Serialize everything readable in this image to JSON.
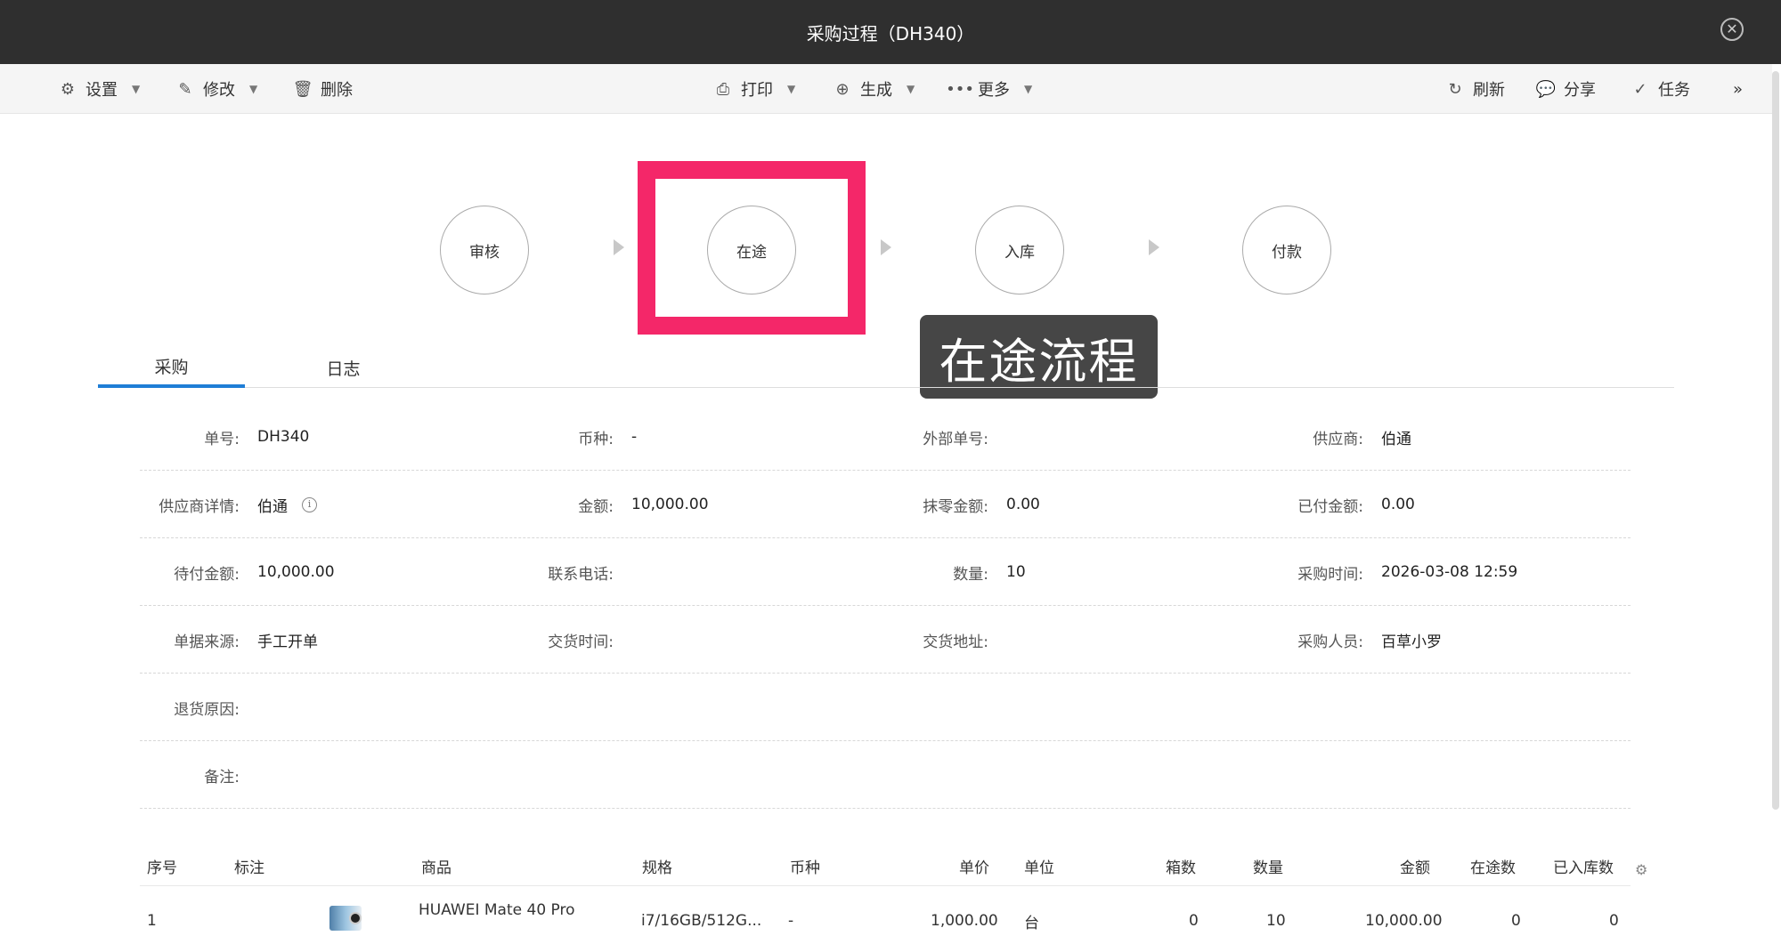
{
  "window": {
    "title": "采购过程（DH340）",
    "close_icon": "close-circle-icon"
  },
  "toolbar": {
    "settings": "设置",
    "edit": "修改",
    "delete": "删除",
    "print": "打印",
    "generate": "生成",
    "more": "更多",
    "refresh": "刷新",
    "share": "分享",
    "task": "任务",
    "expand": "»"
  },
  "workflow": {
    "steps": [
      "审核",
      "在途",
      "入库",
      "付款"
    ],
    "highlighted_step": "在途",
    "highlight_color": "#f42769",
    "tooltip": "在途流程"
  },
  "tabs": [
    {
      "label": "采购",
      "active": true
    },
    {
      "label": "日志",
      "active": false
    }
  ],
  "form": {
    "order_no": {
      "label": "单号:",
      "value": "DH340"
    },
    "currency": {
      "label": "币种:",
      "value": "-"
    },
    "external_no": {
      "label": "外部单号:",
      "value": ""
    },
    "supplier": {
      "label": "供应商:",
      "value": "伯通"
    },
    "supplier_detail": {
      "label": "供应商详情:",
      "value": "伯通"
    },
    "amount": {
      "label": "金额:",
      "value": "10,000.00"
    },
    "rounding": {
      "label": "抹零金额:",
      "value": "0.00"
    },
    "paid": {
      "label": "已付金额:",
      "value": "0.00"
    },
    "unpaid": {
      "label": "待付金额:",
      "value": "10,000.00"
    },
    "phone": {
      "label": "联系电话:",
      "value": ""
    },
    "quantity": {
      "label": "数量:",
      "value": "10"
    },
    "purchase_time": {
      "label": "采购时间:",
      "value": "2026-03-08 12:59"
    },
    "source": {
      "label": "单据来源:",
      "value": "手工开单"
    },
    "delivery_time": {
      "label": "交货时间:",
      "value": ""
    },
    "delivery_address": {
      "label": "交货地址:",
      "value": ""
    },
    "buyer": {
      "label": "采购人员:",
      "value": "百草小罗"
    },
    "return_reason": {
      "label": "退货原因:",
      "value": ""
    },
    "remark": {
      "label": "备注:",
      "value": ""
    }
  },
  "table": {
    "headers": [
      "序号",
      "标注",
      "商品",
      "规格",
      "币种",
      "单价",
      "单位",
      "箱数",
      "数量",
      "金额",
      "在途数",
      "已入库数"
    ],
    "rows": [
      {
        "no": "1",
        "mark": "",
        "product": "HUAWEI Mate 40 Pro",
        "spec": "i7/16GB/512G...",
        "currency": "-",
        "price": "1,000.00",
        "unit": "台",
        "boxes": "0",
        "qty": "10",
        "amount": "10,000.00",
        "in_transit": "0",
        "stocked": "0"
      }
    ]
  }
}
